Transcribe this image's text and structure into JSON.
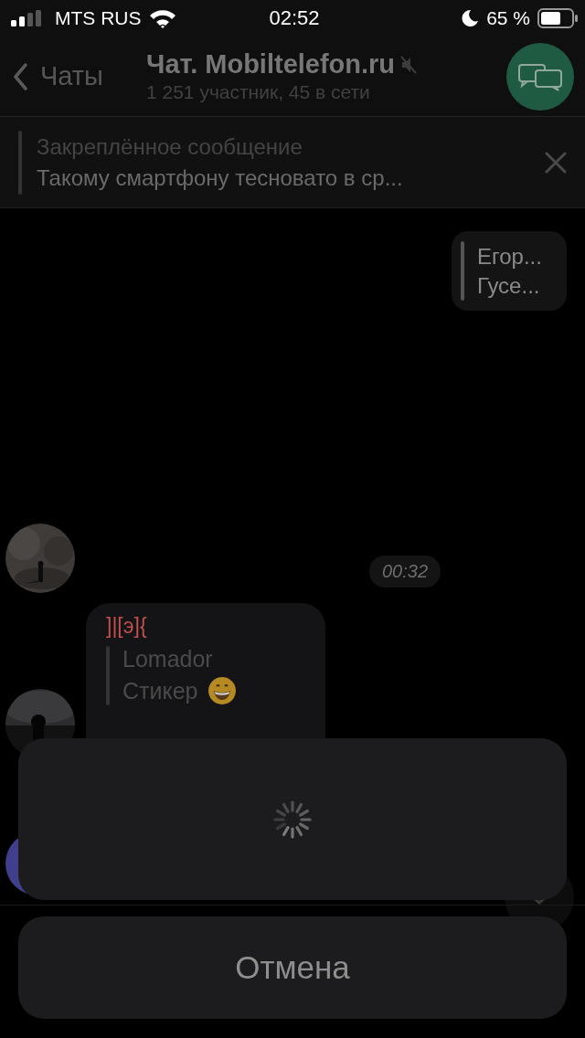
{
  "status_bar": {
    "carrier": "MTS RUS",
    "time": "02:52",
    "battery_percent": "65 %"
  },
  "header": {
    "back_label": "Чаты",
    "title": "Чат. Mobiltelefon.ru",
    "subtitle": "1 251 участник, 45 в сети",
    "muted": true
  },
  "pinned": {
    "label": "Закреплённое сообщение",
    "text": "Такому смартфону тесновато в ср..."
  },
  "messages": [
    {
      "kind": "reply_out",
      "reply_author": "Егор...",
      "reply_text": "Гусе..."
    },
    {
      "kind": "time",
      "text": "00:32"
    },
    {
      "kind": "incoming",
      "author": "]|[э]{",
      "color": "#c0504d",
      "reply_author": "Lomador",
      "reply_text": "Стикер"
    }
  ],
  "action_sheet": {
    "loading": true,
    "cancel": "Отмена"
  }
}
